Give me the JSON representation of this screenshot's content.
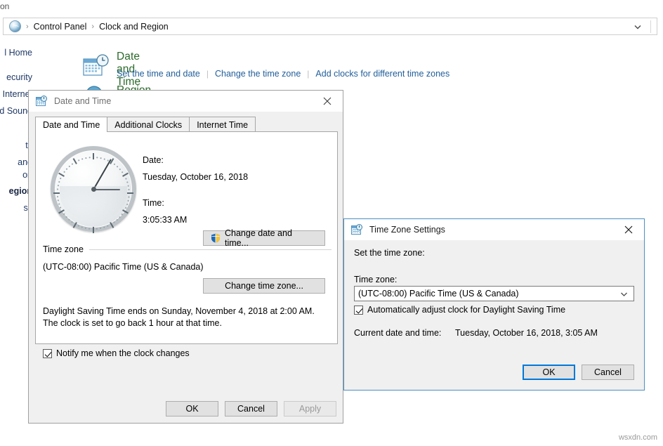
{
  "window": {
    "top_fragment_text": "on",
    "address_bar": {
      "icon": "globe-icon",
      "breadcrumbs": [
        "Control Panel",
        "Clock and Region"
      ],
      "separator": "›",
      "dropdown_icon": "chevron-down-icon"
    }
  },
  "sidebar": {
    "items": [
      {
        "label": "l Home",
        "bold": false
      },
      {
        "label": "ecurity",
        "bold": false
      },
      {
        "label": "Internet",
        "bold": false
      },
      {
        "label": "d Sound",
        "bold": false
      },
      {
        "label": "ts",
        "bold": false
      },
      {
        "label": "and",
        "bold": false
      },
      {
        "label": "on",
        "bold": false
      },
      {
        "label": "egion",
        "bold": true
      },
      {
        "label": "ss",
        "bold": false
      }
    ]
  },
  "content": {
    "category": {
      "icon": "calendar-clock-icon",
      "title": "Date and Time",
      "links": [
        "Set the time and date",
        "Change the time zone",
        "Add clocks for different time zones"
      ]
    },
    "second_category": {
      "icon": "globe-region-icon",
      "title": "Region"
    }
  },
  "date_time_dialog": {
    "title": "Date and Time",
    "title_icon": "calendar-clock-icon",
    "close_icon": "close-icon",
    "tabs": [
      {
        "label": "Date and Time",
        "active": true
      },
      {
        "label": "Additional Clocks",
        "active": false
      },
      {
        "label": "Internet Time",
        "active": false
      }
    ],
    "clock": {
      "name": "analog-clock",
      "hour_angle_deg": 0,
      "minute_angle_deg": -60
    },
    "date_label": "Date:",
    "date_value": "Tuesday, October 16, 2018",
    "time_label": "Time:",
    "time_value": "3:05:33 AM",
    "change_date_time_button": "Change date and time...",
    "change_date_time_icon": "uac-shield-icon",
    "timezone_group_label": "Time zone",
    "timezone_value": "(UTC-08:00) Pacific Time (US & Canada)",
    "change_timezone_button": "Change time zone...",
    "dst_notice": "Daylight Saving Time ends on Sunday, November 4, 2018 at 2:00 AM. The clock is set to go back 1 hour at that time.",
    "notify_checkbox": {
      "label": "Notify me when the clock changes",
      "checked": true
    },
    "footer": {
      "ok": "OK",
      "cancel": "Cancel",
      "apply": "Apply",
      "apply_disabled": true
    }
  },
  "time_zone_dialog": {
    "title": "Time Zone Settings",
    "title_icon": "calendar-clock-icon",
    "close_icon": "close-icon",
    "heading": "Set the time zone:",
    "timezone_label": "Time zone:",
    "timezone_value": "(UTC-08:00) Pacific Time (US & Canada)",
    "timezone_dropdown_icon": "chevron-down-icon",
    "dst_checkbox": {
      "label": "Automatically adjust clock for Daylight Saving Time",
      "checked": true
    },
    "current_label": "Current date and time:",
    "current_value": "Tuesday, October 16, 2018, 3:05 AM",
    "footer": {
      "ok": "OK",
      "cancel": "Cancel",
      "ok_focused": true
    }
  },
  "watermark": "wsxdn.com",
  "colors": {
    "accent": "#0078d7",
    "link": "#215f9a",
    "category_title": "#2a6a2a",
    "sidebar_text": "#1f3864",
    "dialog_bg": "#f0f0f0"
  }
}
